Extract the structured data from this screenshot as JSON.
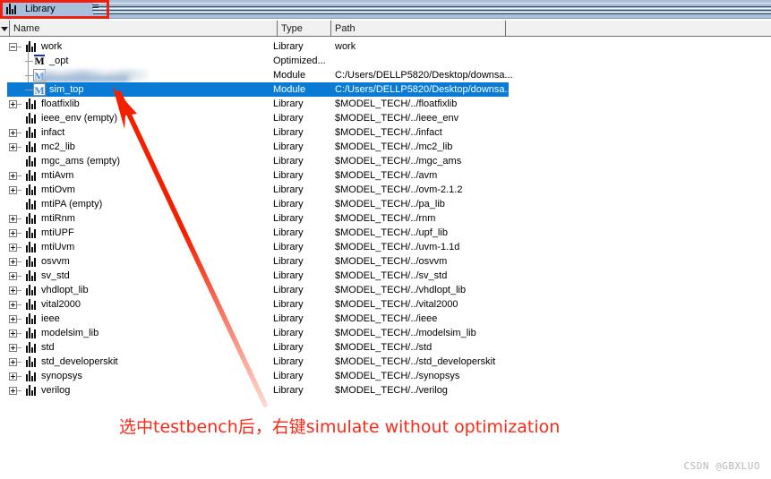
{
  "window": {
    "tab_label": "Library",
    "tab_icon": "library-bars-icon",
    "menu_icon": "tab-menu-icon",
    "highlight_color": "#f01e0f",
    "titlebar_color": "#a8c0dc"
  },
  "columns": {
    "filter_icon": "filter-triangle-icon",
    "name": "Name",
    "type": "Type",
    "path": "Path"
  },
  "selection": {
    "selected_row_name": "sim_top",
    "highlight_color": "#0a7bd4"
  },
  "rows": [
    {
      "name": "work",
      "type": "Library",
      "path": "work",
      "indent": 0,
      "expander": "minus",
      "icon": "library-bars-icon",
      "selected": false
    },
    {
      "name": "_opt",
      "type": "Optimized...",
      "path": "",
      "indent": 1,
      "expander": "none",
      "icon": "module-opt-icon",
      "selected": false
    },
    {
      "name": "",
      "type": "Module",
      "path": "C:/Users/DELLP5820/Desktop/downsa...",
      "indent": 1,
      "expander": "none",
      "icon": "module-icon",
      "selected": false,
      "redacted": true
    },
    {
      "name": "sim_top",
      "type": "Module",
      "path": "C:/Users/DELLP5820/Desktop/downsa...",
      "indent": 1,
      "expander": "none",
      "icon": "module-icon",
      "selected": true
    },
    {
      "name": "floatfixlib",
      "type": "Library",
      "path": "$MODEL_TECH/../floatfixlib",
      "indent": 0,
      "expander": "plus",
      "icon": "library-bars-icon",
      "selected": false
    },
    {
      "name": "ieee_env  (empty)",
      "type": "Library",
      "path": "$MODEL_TECH/../ieee_env",
      "indent": 0,
      "expander": "none",
      "icon": "library-bars-icon",
      "selected": false
    },
    {
      "name": "infact",
      "type": "Library",
      "path": "$MODEL_TECH/../infact",
      "indent": 0,
      "expander": "plus",
      "icon": "library-bars-icon",
      "selected": false
    },
    {
      "name": "mc2_lib",
      "type": "Library",
      "path": "$MODEL_TECH/../mc2_lib",
      "indent": 0,
      "expander": "plus",
      "icon": "library-bars-icon",
      "selected": false
    },
    {
      "name": "mgc_ams  (empty)",
      "type": "Library",
      "path": "$MODEL_TECH/../mgc_ams",
      "indent": 0,
      "expander": "none",
      "icon": "library-bars-icon",
      "selected": false
    },
    {
      "name": "mtiAvm",
      "type": "Library",
      "path": "$MODEL_TECH/../avm",
      "indent": 0,
      "expander": "plus",
      "icon": "library-bars-icon",
      "selected": false
    },
    {
      "name": "mtiOvm",
      "type": "Library",
      "path": "$MODEL_TECH/../ovm-2.1.2",
      "indent": 0,
      "expander": "plus",
      "icon": "library-bars-icon",
      "selected": false
    },
    {
      "name": "mtiPA  (empty)",
      "type": "Library",
      "path": "$MODEL_TECH/../pa_lib",
      "indent": 0,
      "expander": "none",
      "icon": "library-bars-icon",
      "selected": false
    },
    {
      "name": "mtiRnm",
      "type": "Library",
      "path": "$MODEL_TECH/../rnm",
      "indent": 0,
      "expander": "plus",
      "icon": "library-bars-icon",
      "selected": false
    },
    {
      "name": "mtiUPF",
      "type": "Library",
      "path": "$MODEL_TECH/../upf_lib",
      "indent": 0,
      "expander": "plus",
      "icon": "library-bars-icon",
      "selected": false
    },
    {
      "name": "mtiUvm",
      "type": "Library",
      "path": "$MODEL_TECH/../uvm-1.1d",
      "indent": 0,
      "expander": "plus",
      "icon": "library-bars-icon",
      "selected": false
    },
    {
      "name": "osvvm",
      "type": "Library",
      "path": "$MODEL_TECH/../osvvm",
      "indent": 0,
      "expander": "plus",
      "icon": "library-bars-icon",
      "selected": false
    },
    {
      "name": "sv_std",
      "type": "Library",
      "path": "$MODEL_TECH/../sv_std",
      "indent": 0,
      "expander": "plus",
      "icon": "library-bars-icon",
      "selected": false
    },
    {
      "name": "vhdlopt_lib",
      "type": "Library",
      "path": "$MODEL_TECH/../vhdlopt_lib",
      "indent": 0,
      "expander": "plus",
      "icon": "library-bars-icon",
      "selected": false
    },
    {
      "name": "vital2000",
      "type": "Library",
      "path": "$MODEL_TECH/../vital2000",
      "indent": 0,
      "expander": "plus",
      "icon": "library-bars-icon",
      "selected": false
    },
    {
      "name": "ieee",
      "type": "Library",
      "path": "$MODEL_TECH/../ieee",
      "indent": 0,
      "expander": "plus",
      "icon": "library-bars-icon",
      "selected": false
    },
    {
      "name": "modelsim_lib",
      "type": "Library",
      "path": "$MODEL_TECH/../modelsim_lib",
      "indent": 0,
      "expander": "plus",
      "icon": "library-bars-icon",
      "selected": false
    },
    {
      "name": "std",
      "type": "Library",
      "path": "$MODEL_TECH/../std",
      "indent": 0,
      "expander": "plus",
      "icon": "library-bars-icon",
      "selected": false
    },
    {
      "name": "std_developerskit",
      "type": "Library",
      "path": "$MODEL_TECH/../std_developerskit",
      "indent": 0,
      "expander": "plus",
      "icon": "library-bars-icon",
      "selected": false
    },
    {
      "name": "synopsys",
      "type": "Library",
      "path": "$MODEL_TECH/../synopsys",
      "indent": 0,
      "expander": "plus",
      "icon": "library-bars-icon",
      "selected": false
    },
    {
      "name": "verilog",
      "type": "Library",
      "path": "$MODEL_TECH/../verilog",
      "indent": 0,
      "expander": "plus",
      "icon": "library-bars-icon",
      "selected": false
    }
  ],
  "annotation": {
    "arrow_icon": "red-arrow-icon",
    "arrow_color": "#f32000",
    "caption": "选中testbench后，右键simulate without optimization",
    "caption_color": "#fb2a18"
  },
  "watermark": {
    "text": "CSDN @GBXLUO"
  }
}
